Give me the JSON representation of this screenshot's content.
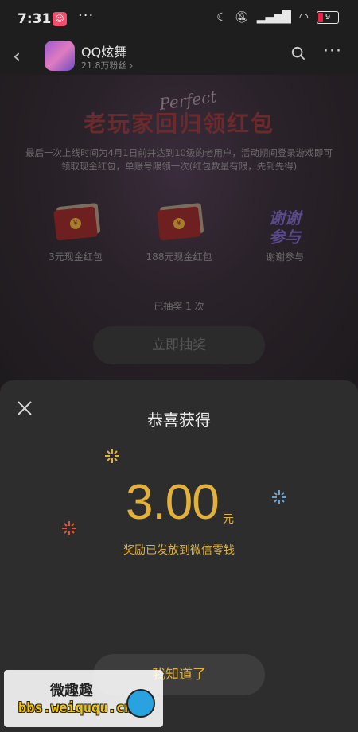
{
  "status_bar": {
    "time": "7:31",
    "battery": "9"
  },
  "app_header": {
    "name": "QQ炫舞",
    "followers": "21.8万粉丝 ›"
  },
  "activity": {
    "perfect": "Perfect",
    "title": "老玩家回归领红包",
    "description": "最后一次上线时间为4月1日前并达到10级的老用户，活动期间登录游戏即可领取现金红包，单账号限领一次(红包数量有限，先到先得)",
    "prizes": [
      {
        "label": "3元现金红包"
      },
      {
        "label": "188元现金红包"
      },
      {
        "label": "谢谢参与",
        "art_line1": "谢谢",
        "art_line2": "参与"
      }
    ],
    "draw_count": "已抽奖 1 次",
    "draw_button": "立即抽奖"
  },
  "result_sheet": {
    "title": "恭喜获得",
    "amount": "3.00",
    "unit": "元",
    "message": "奖励已发放到微信零钱",
    "confirm_button": "我知道了"
  },
  "watermark": {
    "title": "微趣趣",
    "url": "bbs.weiququ.cn"
  },
  "colors": {
    "accent_gold": "#e2b13b",
    "sheet_bg": "#2d2d2d",
    "page_bg": "#1a1a1a"
  }
}
